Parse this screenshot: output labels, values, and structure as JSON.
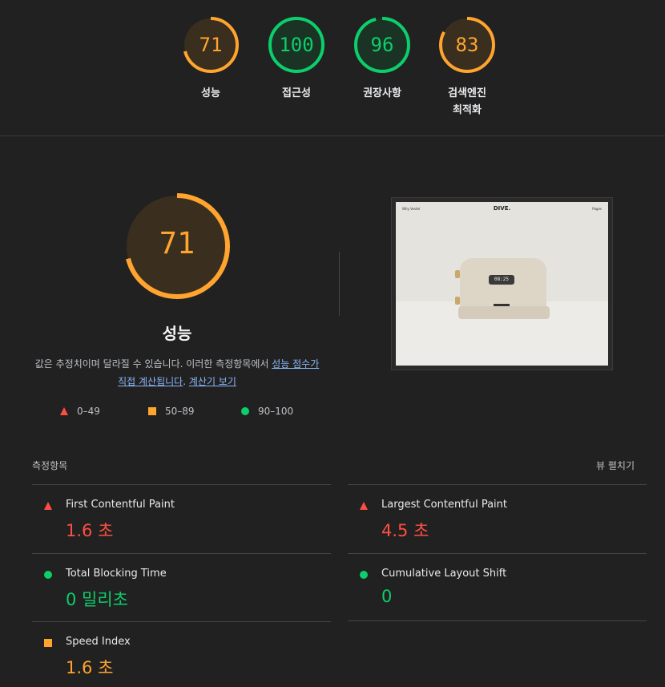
{
  "categories": [
    {
      "score": "71",
      "label": "성능",
      "score_value": 71,
      "color": "#ffa42f"
    },
    {
      "score": "100",
      "label": "접근성",
      "score_value": 100,
      "color": "#0cce6b"
    },
    {
      "score": "96",
      "label": "권장사항",
      "score_value": 96,
      "color": "#0cce6b"
    },
    {
      "score": "83",
      "label": "검색엔진\n최적화",
      "score_value": 83,
      "color": "#ffa42f"
    }
  ],
  "performance": {
    "score": "71",
    "score_value": 71,
    "title": "성능",
    "desc_prefix": "값은 추정치이며 달라질 수 있습니다. 이러한 측정항목에서 ",
    "desc_link1": "성능 점수가 직접 계산됩니다",
    "desc_mid": ". ",
    "desc_link2": "계산기 보기"
  },
  "legend": [
    {
      "range": "0–49",
      "icon": "triangle-icon",
      "color": "#ff4e42"
    },
    {
      "range": "50–89",
      "icon": "square-icon",
      "color": "#ffa42f"
    },
    {
      "range": "90–100",
      "icon": "circle-icon",
      "color": "#0cce6b"
    }
  ],
  "screenshot": {
    "nav_left": "Why   Vestel",
    "logo": "DIVE.",
    "nav_right": "Pages",
    "display": "08:25"
  },
  "metrics_header": "측정항목",
  "expand_label": "뷰 펼치기",
  "metrics": [
    {
      "label": "First Contentful Paint",
      "value": "1.6 초",
      "status": "red"
    },
    {
      "label": "Largest Contentful Paint",
      "value": "4.5 초",
      "status": "red"
    },
    {
      "label": "Total Blocking Time",
      "value": "0 밀리초",
      "status": "green"
    },
    {
      "label": "Cumulative Layout Shift",
      "value": "0",
      "status": "green"
    },
    {
      "label": "Speed Index",
      "value": "1.6 초",
      "status": "orange"
    }
  ]
}
